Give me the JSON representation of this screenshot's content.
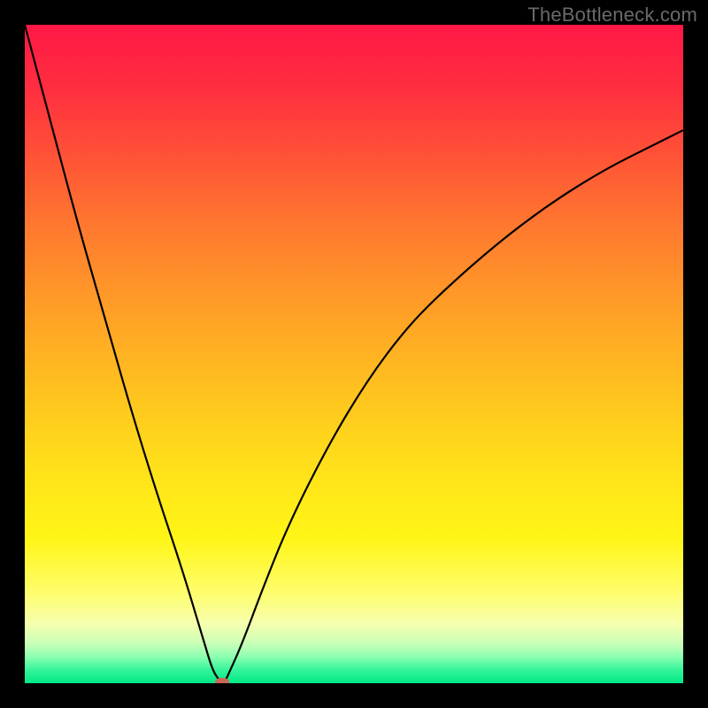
{
  "watermark": {
    "text": "TheBottleneck.com"
  },
  "chart_data": {
    "type": "line",
    "title": "",
    "xlabel": "",
    "ylabel": "",
    "xlim": [
      0,
      100
    ],
    "ylim": [
      0,
      100
    ],
    "grid": false,
    "legend": false,
    "series": [
      {
        "name": "bottleneck-curve",
        "x": [
          0,
          4,
          8,
          12,
          16,
          20,
          24,
          27,
          28.5,
          29.5,
          30,
          30.5,
          31,
          33,
          36,
          40,
          46,
          52,
          58,
          64,
          72,
          80,
          88,
          96,
          100
        ],
        "y": [
          100,
          85,
          70,
          56,
          42,
          29,
          17,
          7,
          2,
          0.5,
          0,
          0.5,
          1.5,
          6,
          14,
          24,
          36,
          46,
          54,
          60,
          67,
          73,
          78,
          82,
          84
        ]
      }
    ],
    "annotations": [
      {
        "name": "min-marker",
        "x": 30,
        "y": 0
      }
    ],
    "background_gradient": {
      "top_color": "#ff1846",
      "bottom_color": "#00e884",
      "description": "red→yellow→green vertical gradient"
    }
  }
}
